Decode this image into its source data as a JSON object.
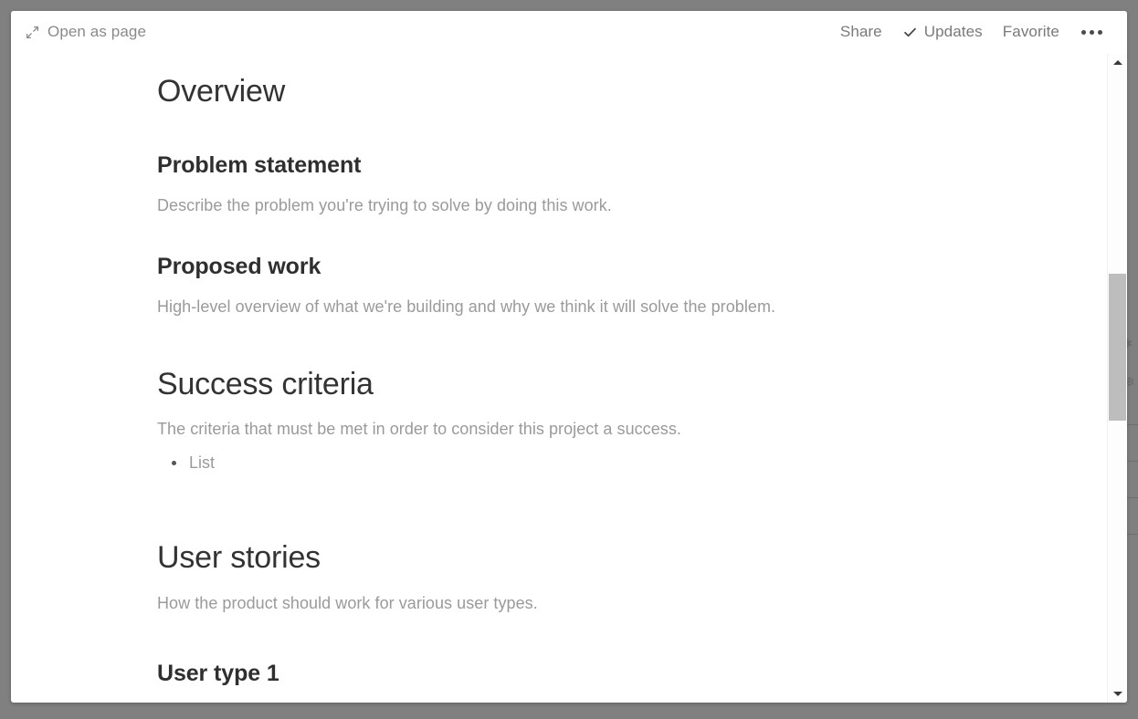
{
  "window": {
    "background_color": "#808080",
    "panel_color": "#ffffff"
  },
  "toolbar": {
    "open_as_page_label": "Open as page",
    "open_as_page_icon": "expand-diagonal-icon",
    "share_label": "Share",
    "updates_label": "Updates",
    "updates_icon": "checkmark-icon",
    "favorite_label": "Favorite",
    "more_icon": "ellipsis-icon",
    "text_color": "#7a7a7a"
  },
  "document": {
    "blocks": [
      {
        "id": "overview",
        "type": "heading1",
        "text": "Overview"
      },
      {
        "id": "problem-statement",
        "type": "heading2",
        "text": "Problem statement"
      },
      {
        "id": "problem-statement-placeholder",
        "type": "placeholder",
        "text": "Describe the problem you're trying to solve by doing this work."
      },
      {
        "id": "proposed-work",
        "type": "heading2",
        "text": "Proposed work"
      },
      {
        "id": "proposed-work-placeholder",
        "type": "placeholder",
        "text": "High-level overview of what we're building and why we think it will solve the problem."
      },
      {
        "id": "success-criteria",
        "type": "heading1",
        "text": "Success criteria"
      },
      {
        "id": "success-criteria-placeholder",
        "type": "placeholder",
        "text": "The criteria that must be met in order to consider this project a success."
      },
      {
        "id": "success-criteria-list-item",
        "type": "bullet",
        "text": "List"
      },
      {
        "id": "user-stories",
        "type": "heading1",
        "text": "User stories"
      },
      {
        "id": "user-stories-placeholder",
        "type": "placeholder",
        "text": "How the product should work for various user types."
      },
      {
        "id": "user-type-1",
        "type": "heading2",
        "text": "User type 1"
      }
    ],
    "heading_color": "#333333",
    "placeholder_color": "#9a9a9a"
  },
  "scrollbar": {
    "orientation": "vertical",
    "up_arrow_icon": "chevron-up-icon",
    "down_arrow_icon": "chevron-down-icon",
    "thumb_top_percent": 33,
    "thumb_height_percent": 24,
    "thumb_color": "#bdbdbd",
    "track_color": "#fdfdfd"
  }
}
